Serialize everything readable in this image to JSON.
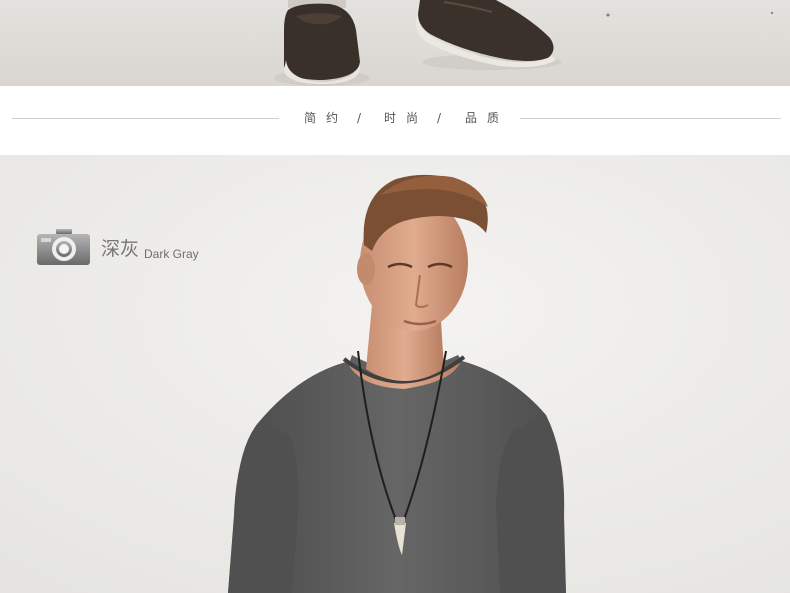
{
  "divider": {
    "words": [
      "简约",
      "时尚",
      "品质"
    ],
    "separator": "/"
  },
  "color_tag": {
    "icon": "camera-icon",
    "name_cn": "深灰",
    "name_en": "Dark Gray"
  },
  "colors": {
    "divider_line": "#cfcfcf",
    "slogan_text": "#555555",
    "shirt": "#5b5b5b",
    "background": "#ededeb"
  }
}
